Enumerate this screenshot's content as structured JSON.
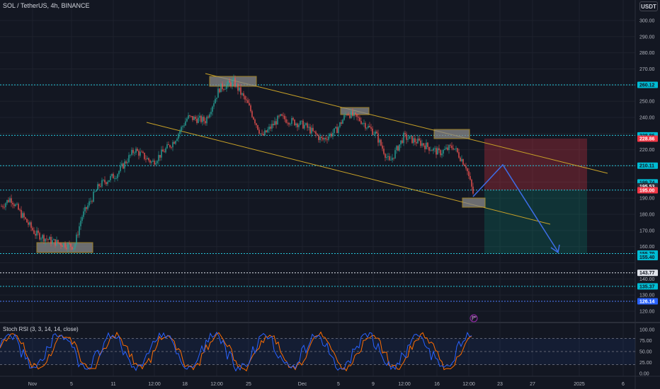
{
  "header": {
    "title": "SOL / TetherUS, 4h, BINANCE",
    "currency_button": "USDT"
  },
  "indicator": {
    "label": "Stoch RSI (3, 3, 14, 14, close)"
  },
  "event_icon": "flag-icon",
  "colors": {
    "background": "#131722",
    "up": "#26a69a",
    "down": "#ef5350",
    "grid": "#1e222d",
    "level_line": "#26c6da",
    "white_level": "#e0e3eb",
    "channel": "#c9a227",
    "zone_fill": "#8a8a8a",
    "arrow": "#3d6ee8",
    "stop_zone": "#f23645",
    "target_zone": "#089981",
    "stoch_k": "#2962ff",
    "stoch_d": "#ff6d00"
  },
  "price_axis": {
    "ticks": [
      "300.00",
      "290.00",
      "280.00",
      "270.00",
      "250.00",
      "240.00",
      "220.00",
      "210.00",
      "190.00",
      "180.00",
      "170.00",
      "160.00",
      "140.00",
      "130.00",
      "120.00"
    ]
  },
  "stoch_axis": {
    "ticks": [
      "100.00",
      "75.00",
      "50.00",
      "25.00",
      "0.00"
    ]
  },
  "time_axis": {
    "labels": [
      "Nov",
      "5",
      "11",
      "12:00",
      "18",
      "12:00",
      "25",
      "Dec",
      "5",
      "9",
      "12:00",
      "16",
      "12:00",
      "23",
      "27",
      "2025",
      "6"
    ]
  },
  "levels": [
    {
      "value": 260.12,
      "label": "260.12",
      "style": "dotted-cyan"
    },
    {
      "value": 228.86,
      "label": "228.86",
      "style": "dotted-cyan"
    },
    {
      "value": 210.11,
      "label": "210.11",
      "style": "dotted-cyan"
    },
    {
      "value": 195.0,
      "label": "195.00",
      "style": "dotted-cyan"
    },
    {
      "value": 155.7,
      "label": "155.70",
      "style": "dotted-cyan"
    },
    {
      "value": 143.77,
      "label": "143.77",
      "style": "dotted-white"
    },
    {
      "value": 135.37,
      "label": "135.37",
      "style": "dotted-cyan"
    },
    {
      "value": 126.14,
      "label": "126.14",
      "style": "dotted-blue"
    }
  ],
  "price_tags": [
    {
      "value": 260.12,
      "label": "260.12",
      "kind": "cyan"
    },
    {
      "value": 228.86,
      "label": "228.86",
      "kind": "cyan"
    },
    {
      "value": 226.86,
      "label": "228.86",
      "kind": "red"
    },
    {
      "value": 210.11,
      "label": "210.11",
      "kind": "cyan"
    },
    {
      "value": 199.74,
      "label": "199.74",
      "kind": "cyan"
    },
    {
      "value": 197.4,
      "label": "195.53",
      "kind": "dark"
    },
    {
      "value": 194.9,
      "label": "195.00",
      "kind": "red"
    },
    {
      "value": 155.7,
      "label": "155.70",
      "kind": "cyan"
    },
    {
      "value": 153.5,
      "label": "155.40",
      "kind": "cyan"
    },
    {
      "value": 143.77,
      "label": "143.77",
      "kind": "white"
    },
    {
      "value": 135.37,
      "label": "135.37",
      "kind": "cyan"
    },
    {
      "value": 126.14,
      "label": "126.14",
      "kind": "blue"
    }
  ]
}
